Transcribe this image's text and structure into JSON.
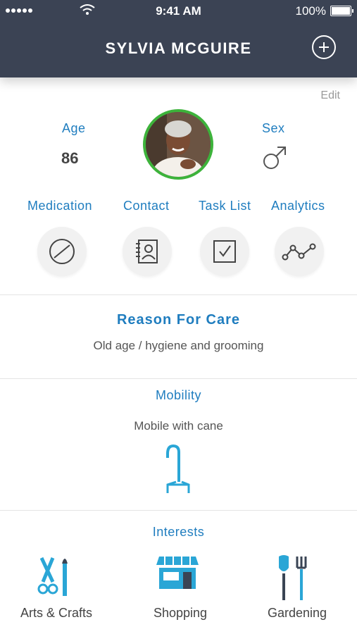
{
  "status_bar": {
    "time": "9:41 AM",
    "battery": "100%"
  },
  "header": {
    "title": "SYLVIA MCGUIRE",
    "add_icon": "plus-circle-icon"
  },
  "profile": {
    "edit_label": "Edit",
    "age_label": "Age",
    "age_value": "86",
    "sex_label": "Sex",
    "sex_icon": "male-symbol-icon"
  },
  "nav": [
    {
      "label": "Medication",
      "icon": "pill-icon"
    },
    {
      "label": "Contact",
      "icon": "contact-book-icon"
    },
    {
      "label": "Task List",
      "icon": "checkbox-icon"
    },
    {
      "label": "Analytics",
      "icon": "line-chart-icon"
    }
  ],
  "reason": {
    "title": "Reason For Care",
    "text": "Old age /  hygiene and grooming"
  },
  "mobility": {
    "title": "Mobility",
    "text": "Mobile with cane",
    "icon": "cane-icon"
  },
  "interests": {
    "title": "Interests",
    "items": [
      {
        "label": "Arts & Crafts",
        "icon": "arts-crafts-icon"
      },
      {
        "label": "Shopping",
        "icon": "storefront-icon"
      },
      {
        "label": "Gardening",
        "icon": "garden-tools-icon"
      }
    ]
  },
  "colors": {
    "header_bg": "#3b4354",
    "accent_blue": "#1f7dbf",
    "avatar_ring": "#3db33b",
    "icon_blue": "#2aa6d6"
  }
}
